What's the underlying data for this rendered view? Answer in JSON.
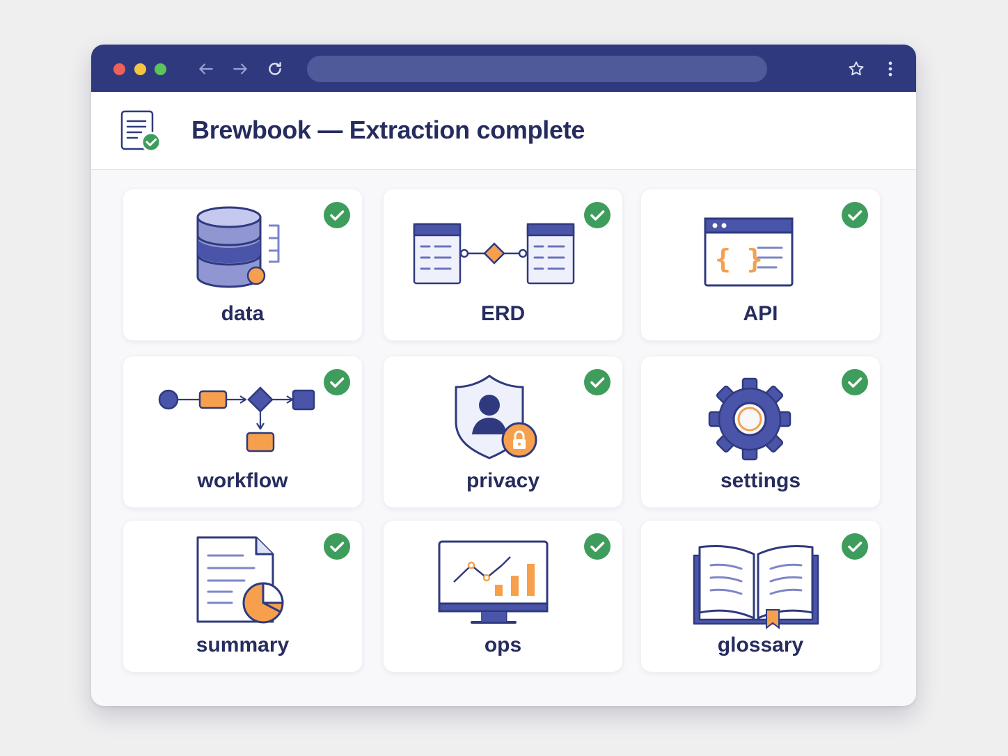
{
  "app": {
    "title": "Brewbook — Extraction complete"
  },
  "browser": {
    "address_value": "",
    "icons": [
      "back-arrow-icon",
      "forward-arrow-icon",
      "reload-icon",
      "star-icon",
      "kebab-menu-icon"
    ]
  },
  "colors": {
    "toolbar": "#2f3a7e",
    "accent": "#4a54a8",
    "orange": "#f6a04d",
    "success": "#3e9d5c",
    "title": "#262c5e"
  },
  "cards": [
    {
      "id": "data",
      "label": "data",
      "status": "complete",
      "icon": "database-icon"
    },
    {
      "id": "erd",
      "label": "ERD",
      "status": "complete",
      "icon": "erd-diagram-icon"
    },
    {
      "id": "api",
      "label": "API",
      "status": "complete",
      "icon": "api-window-icon"
    },
    {
      "id": "workflow",
      "label": "workflow",
      "status": "complete",
      "icon": "workflow-icon"
    },
    {
      "id": "privacy",
      "label": "privacy",
      "status": "complete",
      "icon": "shield-lock-icon"
    },
    {
      "id": "settings",
      "label": "settings",
      "status": "complete",
      "icon": "gear-icon"
    },
    {
      "id": "summary",
      "label": "summary",
      "status": "complete",
      "icon": "report-pie-icon"
    },
    {
      "id": "ops",
      "label": "ops",
      "status": "complete",
      "icon": "monitor-chart-icon"
    },
    {
      "id": "glossary",
      "label": "glossary",
      "status": "complete",
      "icon": "open-book-icon"
    }
  ]
}
